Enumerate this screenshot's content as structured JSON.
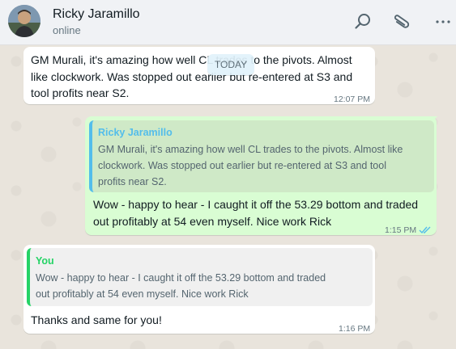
{
  "header": {
    "contact_name": "Ricky Jaramillo",
    "status": "online",
    "icons": [
      "search-icon",
      "attach-icon",
      "menu-icon"
    ]
  },
  "date_chip": "TODAY",
  "messages": [
    {
      "direction": "incoming",
      "text_lines": [
        "GM Murali, it's amazing how well CL trades to the pivots. Almost",
        "like clockwork. Was stopped out earlier but re-entered at S3 and",
        "tool profits near S2."
      ],
      "time": "12:07 PM"
    },
    {
      "direction": "outgoing",
      "quote": {
        "author": "Ricky Jaramillo",
        "text_lines": [
          "GM Murali, it's amazing how well CL trades to the pivots. Almost like",
          "clockwork. Was stopped out earlier but re-entered at S3 and tool",
          "profits near S2."
        ]
      },
      "text_lines": [
        "Wow - happy to hear - I caught it off the 53.29 bottom and traded",
        "out profitably at 54 even myself. Nice work Rick"
      ],
      "time": "1:15 PM",
      "read_status": "double-check-read-icon"
    },
    {
      "direction": "incoming",
      "quote": {
        "author": "You",
        "text_lines": [
          "Wow - happy to hear - I caught it off the 53.29 bottom and traded",
          "out profitably at 54 even myself. Nice work Rick"
        ]
      },
      "text_lines": [
        "Thanks and same for you!"
      ],
      "time": "1:16 PM"
    }
  ],
  "colors": {
    "header_bg": "#f0f2f5",
    "chat_bg": "#e9e4dc",
    "incoming_bubble": "#ffffff",
    "outgoing_bubble": "#d9fdd3",
    "quote_author_contact": "#53bdeb",
    "quote_author_you": "#25d366",
    "read_ticks": "#53bdeb"
  }
}
